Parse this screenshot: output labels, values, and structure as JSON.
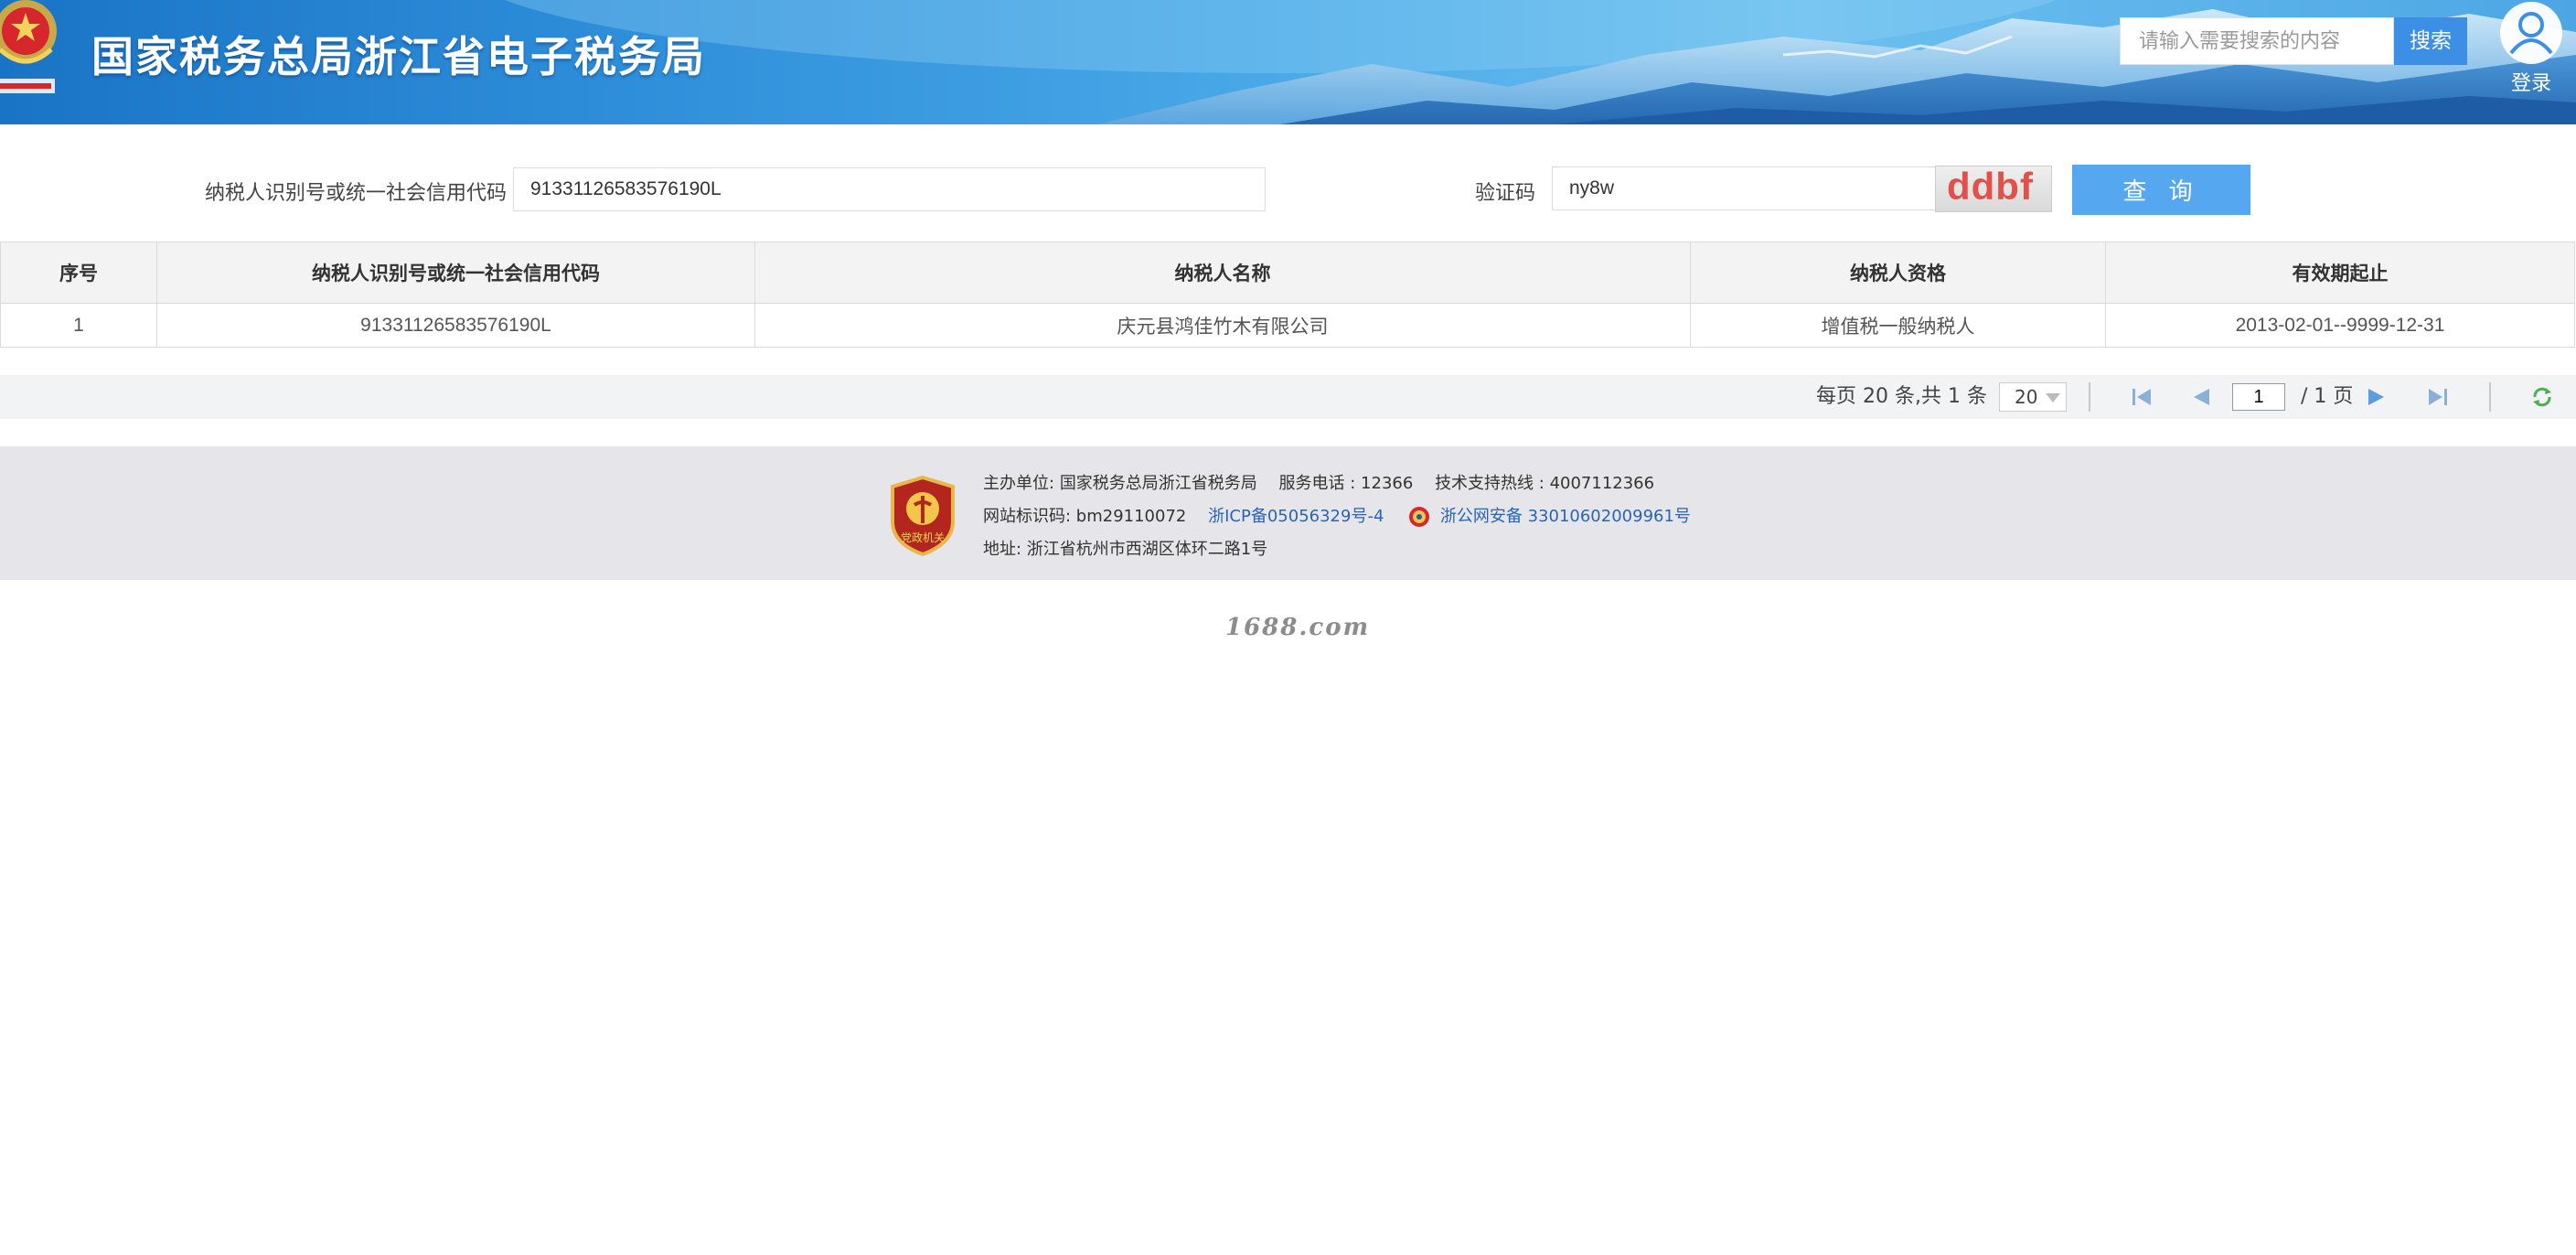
{
  "header": {
    "site_title": "国家税务总局浙江省电子税务局",
    "search_placeholder": "请输入需要搜索的内容",
    "search_button": "搜索",
    "login_label": "登录"
  },
  "query": {
    "taxpayer_id_label": "纳税人识别号或统一社会信用代码",
    "taxpayer_id_value": "91331126583576190L",
    "captcha_label": "验证码",
    "captcha_value": "ny8w",
    "captcha_image_text": "ddbf",
    "query_button": "查 询"
  },
  "table": {
    "headers": [
      "序号",
      "纳税人识别号或统一社会信用代码",
      "纳税人名称",
      "纳税人资格",
      "有效期起止"
    ],
    "rows": [
      [
        "1",
        "91331126583576190L",
        "庆元县鸿佳竹木有限公司",
        "增值税一般纳税人",
        "2013-02-01--9999-12-31"
      ]
    ]
  },
  "pager": {
    "summary": "每页 20 条,共 1 条",
    "page_size": "20",
    "current_page": "1",
    "total_pages": "/ 1 页"
  },
  "footer": {
    "host_label": "主办单位:",
    "host": "国家税务总局浙江省税务局",
    "service_phone": "服务电话 : 12366",
    "support_hotline": "技术支持热线 : 4007112366",
    "site_id": "网站标识码:  bm29110072",
    "icp": "浙ICP备05056329号-4",
    "police": "浙公网安备 33010602009961号",
    "address": "地址:  浙江省杭州市西湖区体环二路1号",
    "badge_text": "党政机关"
  },
  "watermark": "1688.com",
  "colors": {
    "accent_blue": "#55a7ef",
    "search_blue": "#3d8fe5",
    "link_blue": "#2a64b3",
    "captcha_red": "#e2504a"
  }
}
